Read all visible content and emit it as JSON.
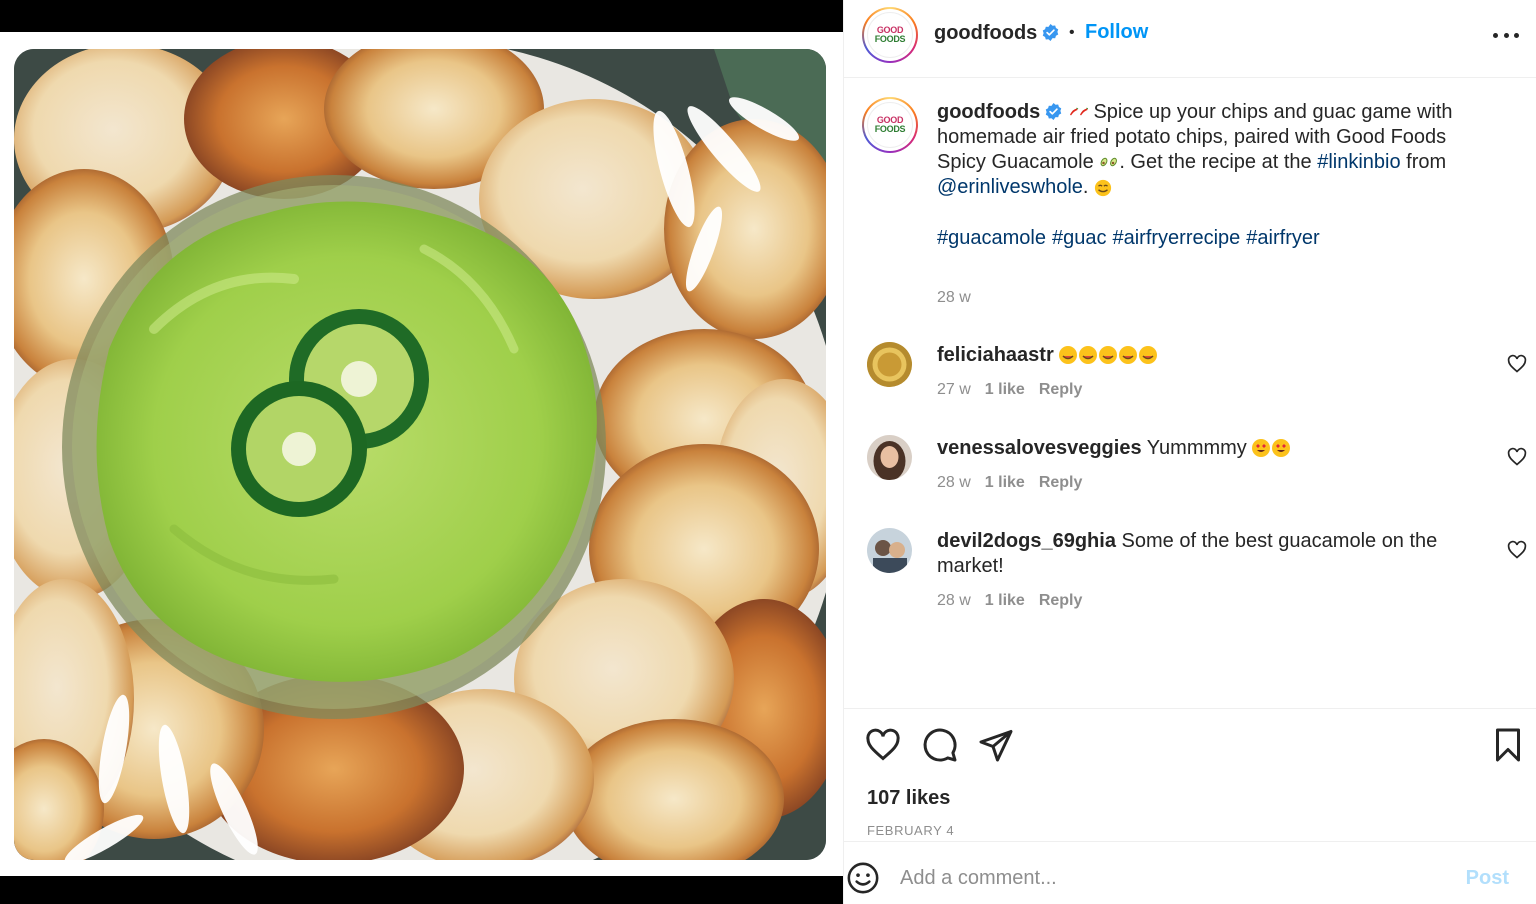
{
  "account": {
    "username": "goodfoods",
    "follow_label": "Follow",
    "logo_top": "GOOD",
    "logo_bottom": "FOODS"
  },
  "caption": {
    "username": "goodfoods",
    "text_1": "Spice up your chips and guac game with homemade air fried potato chips, paired with Good Foods Spicy Guacamole",
    "text_2": ". Get the recipe at the",
    "link_tag": "#linkinbio",
    "text_3": "from",
    "mention": "@erinliveswhole",
    "text_4": ".",
    "hashtags": [
      "#guacamole",
      "#guac",
      "#airfryerrecipe",
      "#airfryer"
    ],
    "time": "28 w"
  },
  "comments": [
    {
      "username": "feliciahaastr",
      "text": "",
      "time": "27 w",
      "likes": "1 like",
      "reply": "Reply"
    },
    {
      "username": "venessalovesveggies",
      "text": "Yummmmy",
      "time": "28 w",
      "likes": "1 like",
      "reply": "Reply"
    },
    {
      "username": "devil2dogs_69ghia",
      "text": "Some of the best guacamole on the market!",
      "time": "28 w",
      "likes": "1 like",
      "reply": "Reply"
    }
  ],
  "post": {
    "likes": "107 likes",
    "date": "FEBRUARY 4"
  },
  "comment_box": {
    "placeholder": "Add a comment...",
    "post_label": "Post"
  },
  "icons": [
    "heart-icon",
    "comment-icon",
    "share-icon",
    "bookmark-icon",
    "more-icon",
    "verified-icon",
    "emoji-icon"
  ],
  "colors": {
    "link": "#00376b",
    "follow": "#0095f6",
    "post_disabled": "#b2dffc",
    "muted": "#8e8e8e",
    "verified": "#3897f0"
  }
}
